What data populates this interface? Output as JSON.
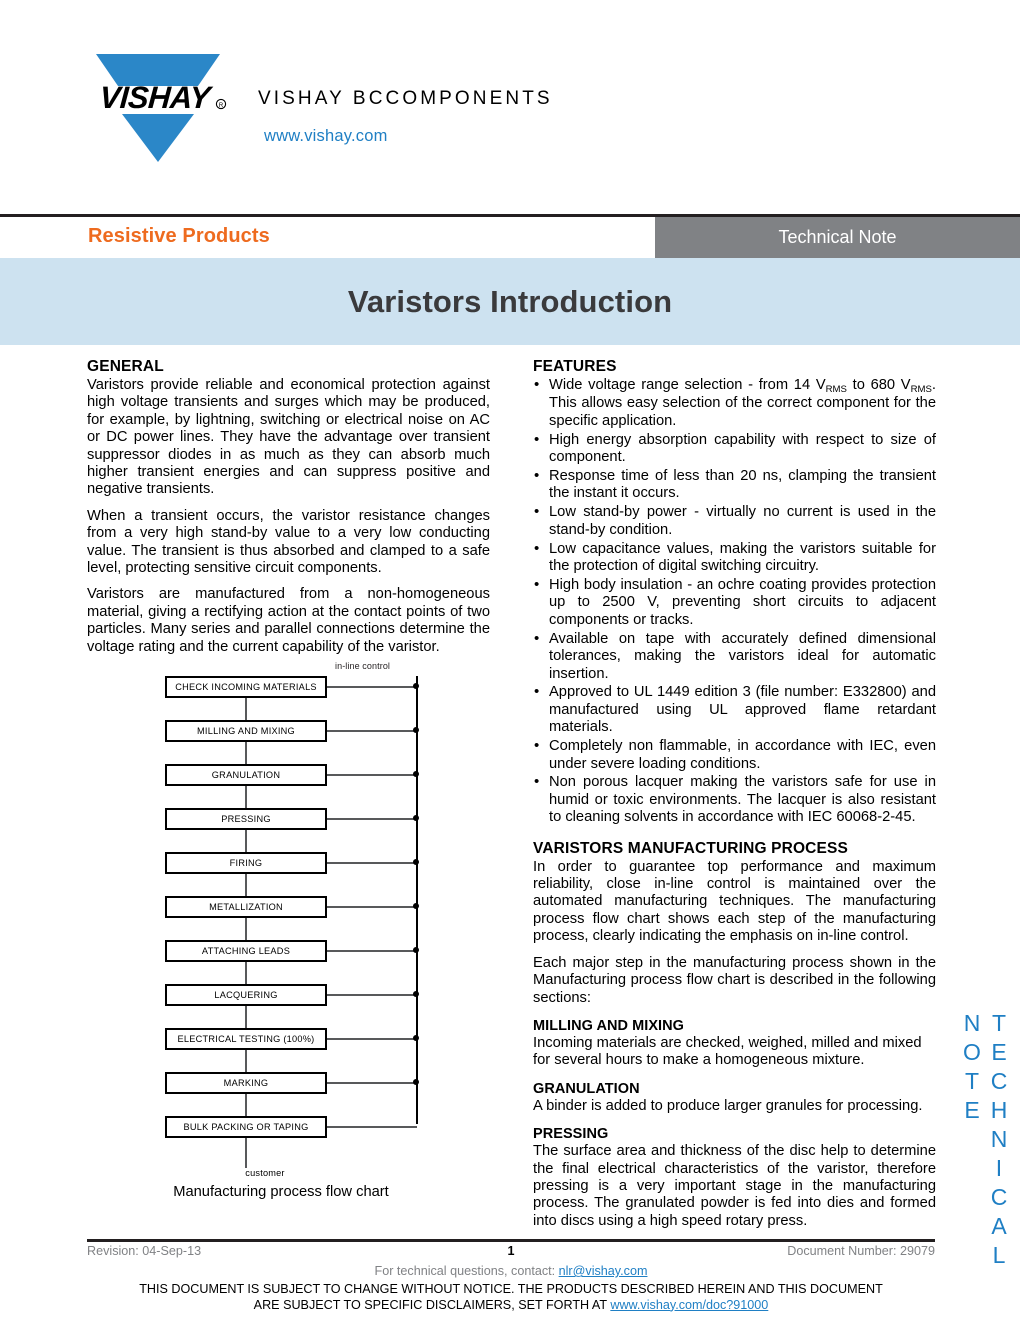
{
  "brand": {
    "logo_text": "VISHAY",
    "logo_mark": "vishay-triangle-logo",
    "company": "VISHAY BCCOMPONENTS",
    "website": "www.vishay.com"
  },
  "header": {
    "category": "Resistive Products",
    "doc_type": "Technical Note",
    "title": "Varistors Introduction"
  },
  "side_tab": "TECHNICAL NOTE",
  "general": {
    "heading": "GENERAL",
    "paragraphs": [
      "Varistors provide reliable and economical protection against high voltage transients and surges which may be produced, for example, by lightning, switching or electrical noise on AC or DC power lines. They have the advantage over transient suppressor diodes in as much as they can absorb much higher transient energies and can suppress positive and negative transients.",
      "When a transient occurs, the varistor resistance changes from a very high stand-by value to a very low conducting value. The transient is thus absorbed and clamped to a safe level, protecting sensitive circuit components.",
      "Varistors are manufactured from a non-homogeneous material, giving a rectifying action at the contact points of two particles. Many series and parallel connections determine the voltage rating and the current capability of the varistor."
    ]
  },
  "features": {
    "heading": "FEATURES",
    "items": [
      "Wide voltage range selection - from 14 VRMS to 680 VRMS. This allows easy selection of the correct component for the specific application.",
      "High energy absorption capability with respect to size of component.",
      "Response time of less than 20 ns, clamping the transient the instant it occurs.",
      "Low stand-by power - virtually no current is used in the stand-by condition.",
      "Low capacitance values, making the varistors suitable for the protection of digital switching circuitry.",
      "High body insulation - an ochre coating provides protection up to 2500 V, preventing short circuits to adjacent components or tracks.",
      "Available on tape with accurately defined dimensional tolerances, making the varistors ideal for automatic insertion.",
      "Approved to UL 1449 edition 3 (file number: E332800) and manufactured using UL approved flame retardant materials.",
      "Completely non flammable, in accordance with IEC, even under severe loading conditions.",
      "Non porous lacquer making the varistors safe for use in humid or toxic environments. The lacquer is also resistant to cleaning solvents in accordance with IEC 60068-2-45."
    ]
  },
  "manufacturing": {
    "heading": "VARISTORS MANUFACTURING PROCESS",
    "paragraphs": [
      "In order to guarantee top performance and maximum reliability, close in-line control is maintained over the automated manufacturing techniques. The manufacturing process flow chart shows each step of the manufacturing process, clearly indicating the emphasis on in-line control.",
      "Each major step in the manufacturing process shown in the Manufacturing process flow chart is described in the following sections:"
    ],
    "subsections": [
      {
        "heading": "MILLING AND MIXING",
        "text": "Incoming materials are checked, weighed, milled and mixed for several hours to make a homogeneous mixture."
      },
      {
        "heading": "GRANULATION",
        "text": "A binder is added to produce larger granules for processing."
      },
      {
        "heading": "PRESSING",
        "text": "The surface area and thickness of the disc help to determine the final electrical characteristics of the varistor, therefore pressing is a very important stage in the manufacturing process. The granulated powder is fed into dies and formed into discs using a high speed rotary press."
      }
    ]
  },
  "flowchart": {
    "caption": "Manufacturing process flow chart",
    "inline_control_label": "in-line control",
    "customer_label": "customer",
    "steps": [
      "CHECK INCOMING MATERIALS",
      "MILLING AND MIXING",
      "GRANULATION",
      "PRESSING",
      "FIRING",
      "METALLIZATION",
      "ATTACHING LEADS",
      "LACQUERING",
      "ELECTRICAL TESTING (100%)",
      "MARKING",
      "BULK PACKING OR TAPING"
    ]
  },
  "footer": {
    "revision": "Revision: 04-Sep-13",
    "page": "1",
    "document_number": "Document Number: 29079",
    "contact_prefix": "For technical questions, contact: ",
    "contact_email": "nlr@vishay.com",
    "disclaimer_line1": "THIS DOCUMENT IS SUBJECT TO CHANGE WITHOUT NOTICE. THE PRODUCTS DESCRIBED HEREIN AND THIS DOCUMENT",
    "disclaimer_line2_prefix": "ARE SUBJECT TO SPECIFIC DISCLAIMERS, SET FORTH AT ",
    "disclaimer_link": "www.vishay.com/doc?91000"
  },
  "colors": {
    "accent_orange": "#ee6b1f",
    "brand_blue": "#1f7fc4",
    "title_band": "#cde2f0",
    "doc_type_bg": "#808285"
  }
}
